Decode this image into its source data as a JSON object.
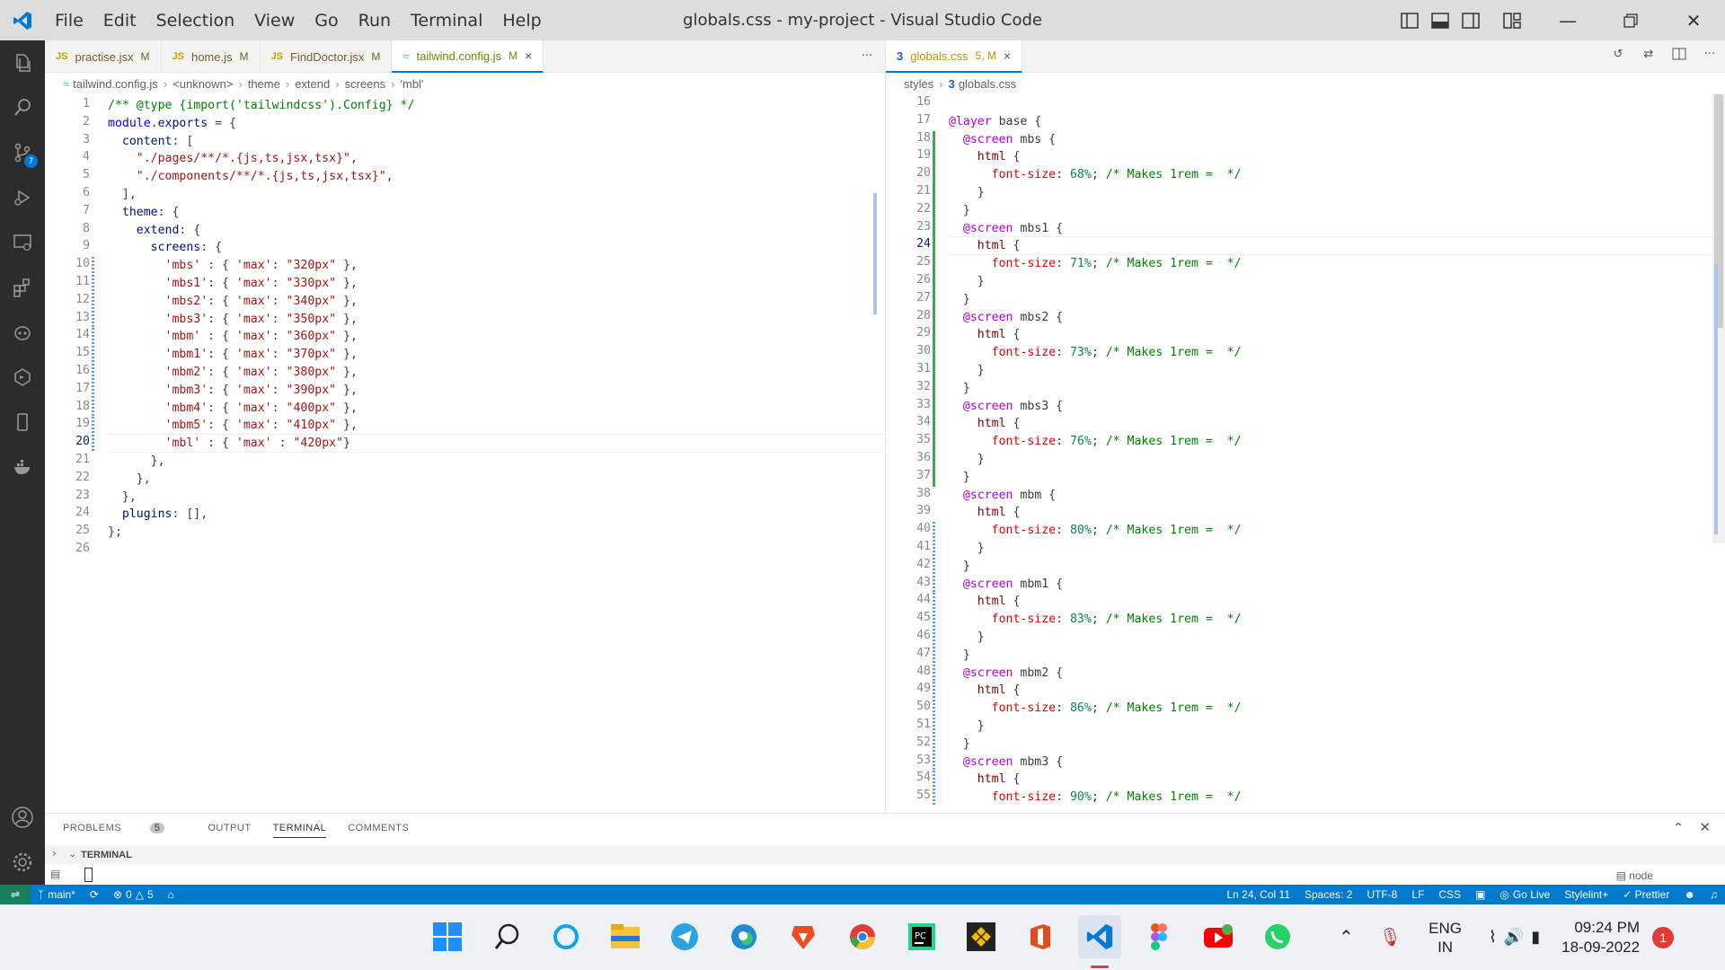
{
  "titlebar": {
    "title": "globals.css - my-project - Visual Studio Code",
    "menu": [
      "File",
      "Edit",
      "Selection",
      "View",
      "Go",
      "Run",
      "Terminal",
      "Help"
    ]
  },
  "left_editor": {
    "tabs": [
      {
        "icon": "JS",
        "name": "practise.jsx",
        "status": "M"
      },
      {
        "icon": "JS",
        "name": "home.js",
        "status": "M"
      },
      {
        "icon": "JS",
        "name": "FindDoctor.jsx",
        "status": "M"
      },
      {
        "icon": "tw",
        "name": "tailwind.config.js",
        "status": "M",
        "active": true
      }
    ],
    "more": "···",
    "breadcrumb": [
      "tailwind.config.js",
      "<unknown>",
      "theme",
      "extend",
      "screens",
      "'mbl'"
    ],
    "current_line": 20
  },
  "right_editor": {
    "tab": {
      "name": "globals.css",
      "status": "5, M"
    },
    "breadcrumb": [
      "styles",
      "globals.css"
    ],
    "current_line": 24
  },
  "panel": {
    "tabs": [
      "PROBLEMS",
      "OUTPUT",
      "TERMINAL",
      "COMMENTS"
    ],
    "problems_count": "5",
    "active_tab": "TERMINAL",
    "section": "TERMINAL",
    "node_label": "node"
  },
  "statusbar": {
    "branch": "main*",
    "errors": "0",
    "warnings": "5",
    "cursor": "Ln 24, Col 11",
    "spaces": "Spaces: 2",
    "encoding": "UTF-8",
    "eol": "LF",
    "language": "CSS",
    "golive": "Go Live",
    "stylelint": "Stylelint+",
    "prettier": "✓ Prettier"
  },
  "taskbar": {
    "lang1": "ENG",
    "lang2": "IN",
    "time": "09:24 PM",
    "date": "18-09-2022",
    "notifications": "1"
  },
  "colors": {
    "accent": "#007acc",
    "activity": "#2c2c2c",
    "titlebar": "#dddddd"
  }
}
